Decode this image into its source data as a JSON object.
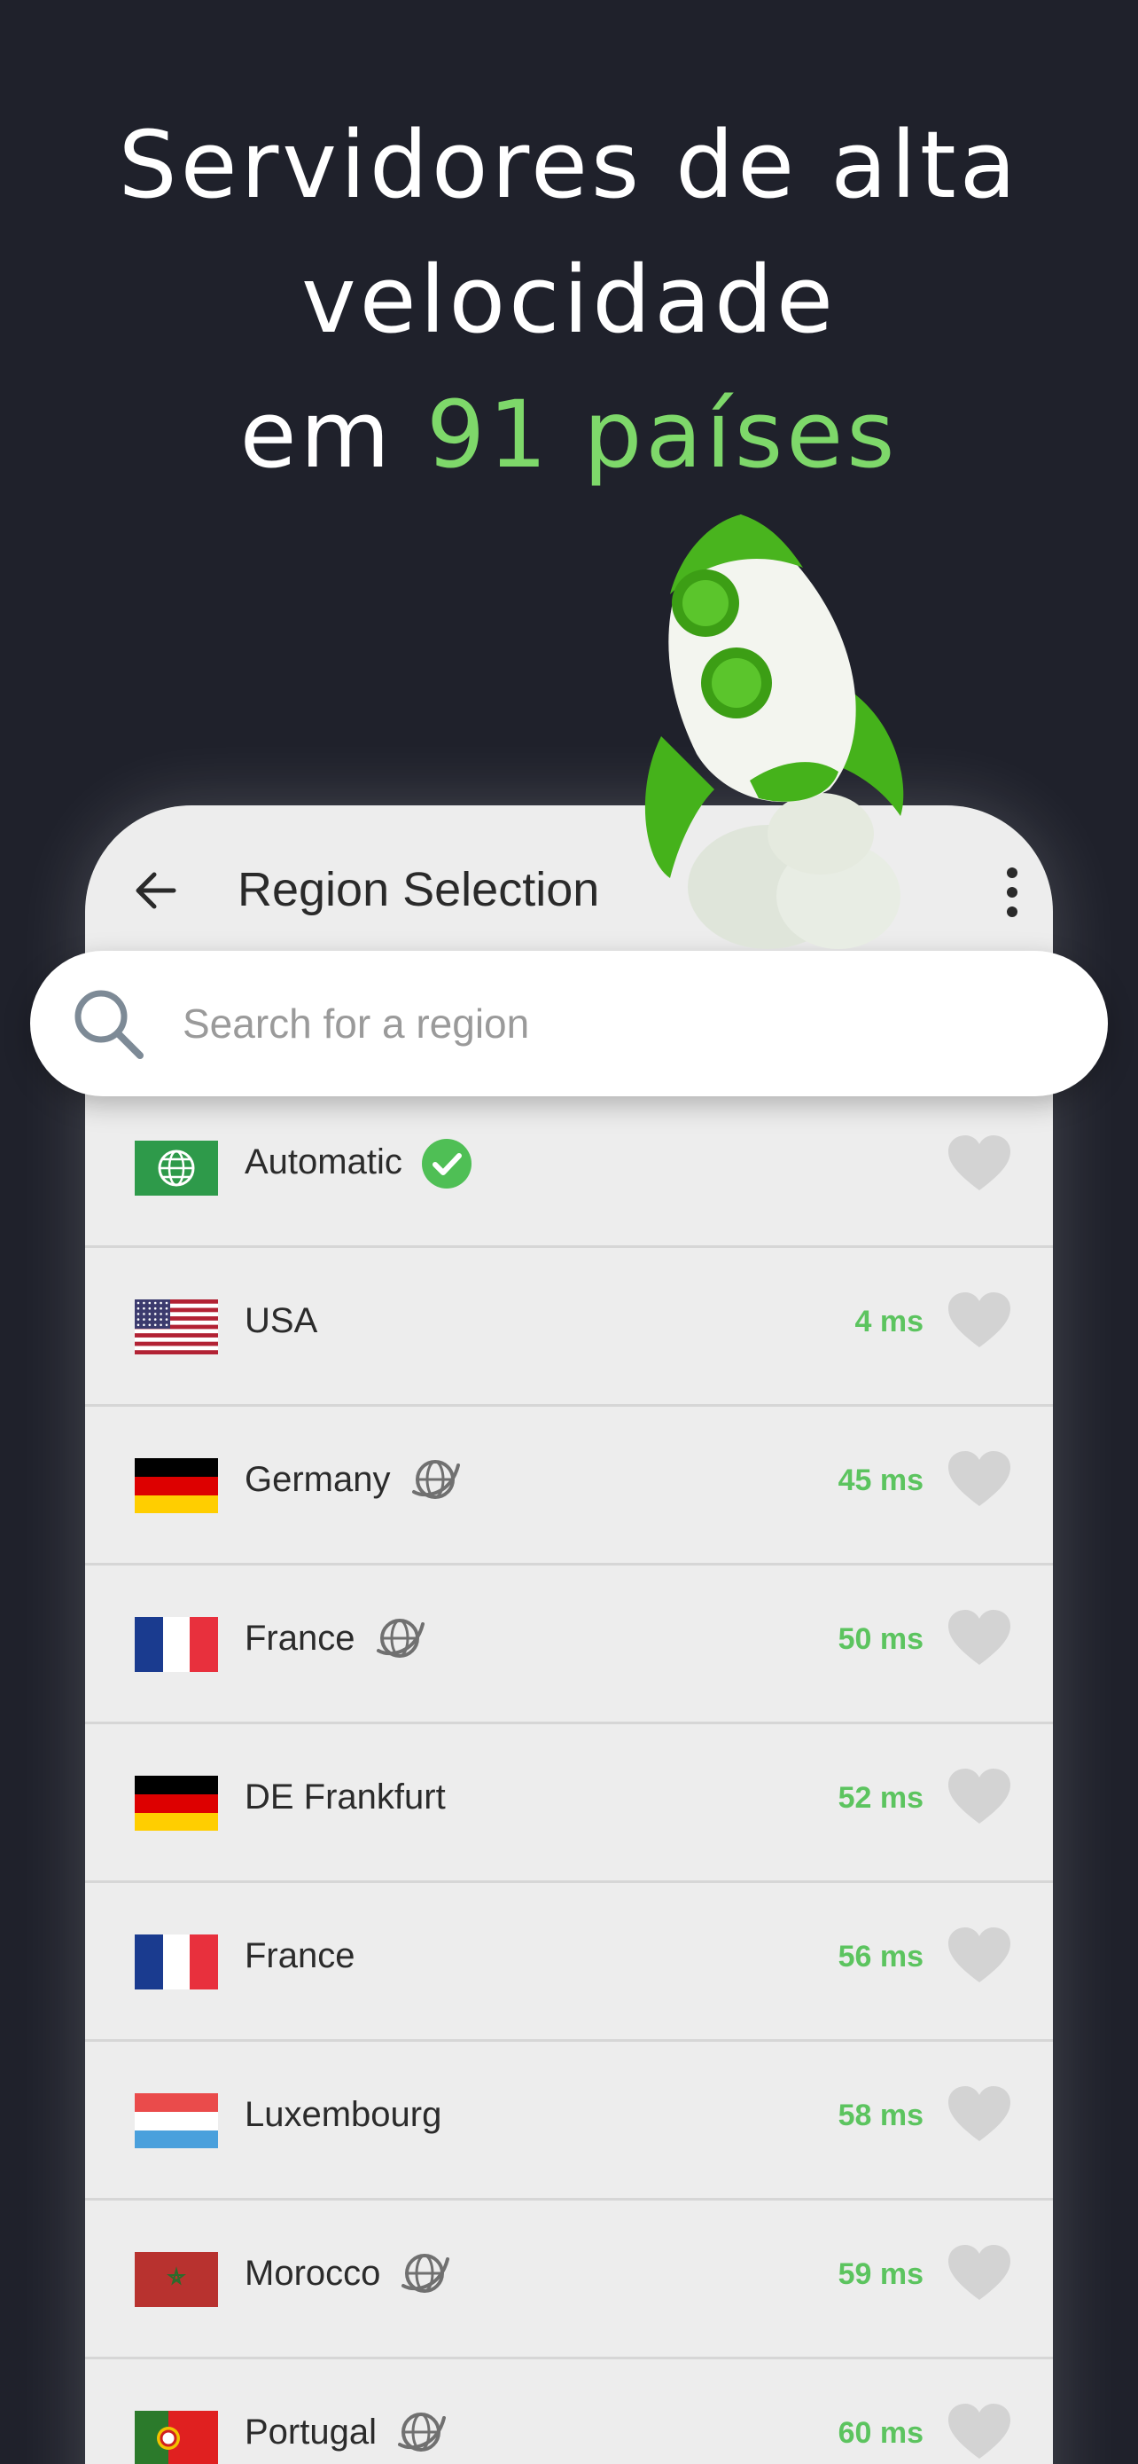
{
  "headline": {
    "line1": "Servidores de alta",
    "line2": "velocidade",
    "line3_prefix": "em ",
    "line3_accent": "91 países"
  },
  "appbar": {
    "title": "Region Selection"
  },
  "search": {
    "placeholder": "Search for a region"
  },
  "regions": [
    {
      "name": "Automatic",
      "latency": "",
      "flag": "globe",
      "badge": "selected-check"
    },
    {
      "name": "USA",
      "latency": "4 ms",
      "flag": "us",
      "badge": ""
    },
    {
      "name": "Germany",
      "latency": "45 ms",
      "flag": "de",
      "badge": "streaming-globe"
    },
    {
      "name": "France",
      "latency": "50 ms",
      "flag": "fr",
      "badge": "streaming-globe"
    },
    {
      "name": "DE Frankfurt",
      "latency": "52 ms",
      "flag": "de",
      "badge": ""
    },
    {
      "name": "France",
      "latency": "56 ms",
      "flag": "fr",
      "badge": ""
    },
    {
      "name": "Luxembourg",
      "latency": "58 ms",
      "flag": "lu",
      "badge": ""
    },
    {
      "name": "Morocco",
      "latency": "59 ms",
      "flag": "ma",
      "badge": "streaming-globe"
    },
    {
      "name": "Portugal",
      "latency": "60 ms",
      "flag": "pt",
      "badge": "streaming-globe"
    }
  ],
  "colors": {
    "background": "#1f212b",
    "accent": "#7ed86a",
    "latency": "#5cc45f",
    "panel": "#ededed"
  }
}
